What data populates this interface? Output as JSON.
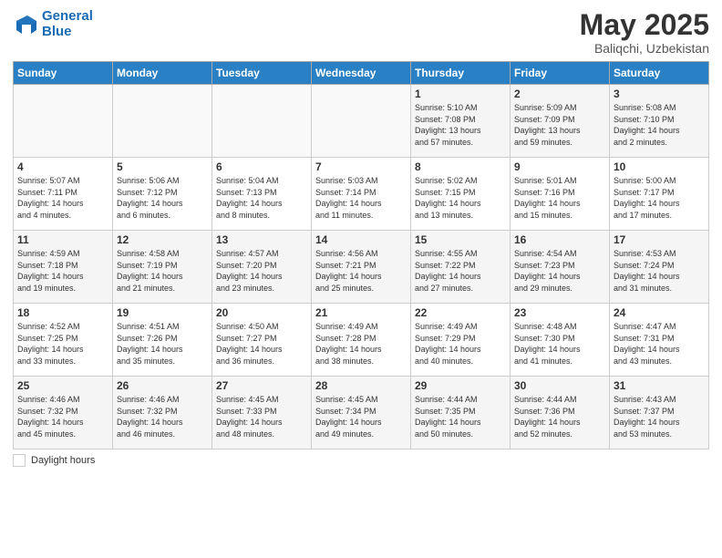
{
  "logo": {
    "line1": "General",
    "line2": "Blue"
  },
  "title": "May 2025",
  "subtitle": "Baliqchi, Uzbekistan",
  "days_of_week": [
    "Sunday",
    "Monday",
    "Tuesday",
    "Wednesday",
    "Thursday",
    "Friday",
    "Saturday"
  ],
  "footer": {
    "label": "Daylight hours"
  },
  "weeks": [
    [
      {
        "day": "",
        "info": ""
      },
      {
        "day": "",
        "info": ""
      },
      {
        "day": "",
        "info": ""
      },
      {
        "day": "",
        "info": ""
      },
      {
        "day": "1",
        "info": "Sunrise: 5:10 AM\nSunset: 7:08 PM\nDaylight: 13 hours\nand 57 minutes."
      },
      {
        "day": "2",
        "info": "Sunrise: 5:09 AM\nSunset: 7:09 PM\nDaylight: 13 hours\nand 59 minutes."
      },
      {
        "day": "3",
        "info": "Sunrise: 5:08 AM\nSunset: 7:10 PM\nDaylight: 14 hours\nand 2 minutes."
      }
    ],
    [
      {
        "day": "4",
        "info": "Sunrise: 5:07 AM\nSunset: 7:11 PM\nDaylight: 14 hours\nand 4 minutes."
      },
      {
        "day": "5",
        "info": "Sunrise: 5:06 AM\nSunset: 7:12 PM\nDaylight: 14 hours\nand 6 minutes."
      },
      {
        "day": "6",
        "info": "Sunrise: 5:04 AM\nSunset: 7:13 PM\nDaylight: 14 hours\nand 8 minutes."
      },
      {
        "day": "7",
        "info": "Sunrise: 5:03 AM\nSunset: 7:14 PM\nDaylight: 14 hours\nand 11 minutes."
      },
      {
        "day": "8",
        "info": "Sunrise: 5:02 AM\nSunset: 7:15 PM\nDaylight: 14 hours\nand 13 minutes."
      },
      {
        "day": "9",
        "info": "Sunrise: 5:01 AM\nSunset: 7:16 PM\nDaylight: 14 hours\nand 15 minutes."
      },
      {
        "day": "10",
        "info": "Sunrise: 5:00 AM\nSunset: 7:17 PM\nDaylight: 14 hours\nand 17 minutes."
      }
    ],
    [
      {
        "day": "11",
        "info": "Sunrise: 4:59 AM\nSunset: 7:18 PM\nDaylight: 14 hours\nand 19 minutes."
      },
      {
        "day": "12",
        "info": "Sunrise: 4:58 AM\nSunset: 7:19 PM\nDaylight: 14 hours\nand 21 minutes."
      },
      {
        "day": "13",
        "info": "Sunrise: 4:57 AM\nSunset: 7:20 PM\nDaylight: 14 hours\nand 23 minutes."
      },
      {
        "day": "14",
        "info": "Sunrise: 4:56 AM\nSunset: 7:21 PM\nDaylight: 14 hours\nand 25 minutes."
      },
      {
        "day": "15",
        "info": "Sunrise: 4:55 AM\nSunset: 7:22 PM\nDaylight: 14 hours\nand 27 minutes."
      },
      {
        "day": "16",
        "info": "Sunrise: 4:54 AM\nSunset: 7:23 PM\nDaylight: 14 hours\nand 29 minutes."
      },
      {
        "day": "17",
        "info": "Sunrise: 4:53 AM\nSunset: 7:24 PM\nDaylight: 14 hours\nand 31 minutes."
      }
    ],
    [
      {
        "day": "18",
        "info": "Sunrise: 4:52 AM\nSunset: 7:25 PM\nDaylight: 14 hours\nand 33 minutes."
      },
      {
        "day": "19",
        "info": "Sunrise: 4:51 AM\nSunset: 7:26 PM\nDaylight: 14 hours\nand 35 minutes."
      },
      {
        "day": "20",
        "info": "Sunrise: 4:50 AM\nSunset: 7:27 PM\nDaylight: 14 hours\nand 36 minutes."
      },
      {
        "day": "21",
        "info": "Sunrise: 4:49 AM\nSunset: 7:28 PM\nDaylight: 14 hours\nand 38 minutes."
      },
      {
        "day": "22",
        "info": "Sunrise: 4:49 AM\nSunset: 7:29 PM\nDaylight: 14 hours\nand 40 minutes."
      },
      {
        "day": "23",
        "info": "Sunrise: 4:48 AM\nSunset: 7:30 PM\nDaylight: 14 hours\nand 41 minutes."
      },
      {
        "day": "24",
        "info": "Sunrise: 4:47 AM\nSunset: 7:31 PM\nDaylight: 14 hours\nand 43 minutes."
      }
    ],
    [
      {
        "day": "25",
        "info": "Sunrise: 4:46 AM\nSunset: 7:32 PM\nDaylight: 14 hours\nand 45 minutes."
      },
      {
        "day": "26",
        "info": "Sunrise: 4:46 AM\nSunset: 7:32 PM\nDaylight: 14 hours\nand 46 minutes."
      },
      {
        "day": "27",
        "info": "Sunrise: 4:45 AM\nSunset: 7:33 PM\nDaylight: 14 hours\nand 48 minutes."
      },
      {
        "day": "28",
        "info": "Sunrise: 4:45 AM\nSunset: 7:34 PM\nDaylight: 14 hours\nand 49 minutes."
      },
      {
        "day": "29",
        "info": "Sunrise: 4:44 AM\nSunset: 7:35 PM\nDaylight: 14 hours\nand 50 minutes."
      },
      {
        "day": "30",
        "info": "Sunrise: 4:44 AM\nSunset: 7:36 PM\nDaylight: 14 hours\nand 52 minutes."
      },
      {
        "day": "31",
        "info": "Sunrise: 4:43 AM\nSunset: 7:37 PM\nDaylight: 14 hours\nand 53 minutes."
      }
    ]
  ]
}
